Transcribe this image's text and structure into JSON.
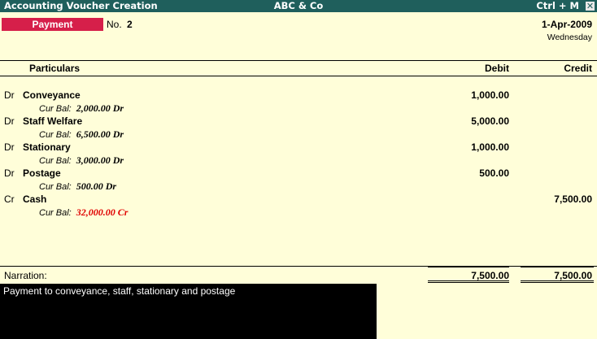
{
  "titlebar": {
    "left": "Accounting Voucher  Creation",
    "center": "ABC & Co",
    "right": "Ctrl + M",
    "close": "✕"
  },
  "voucher": {
    "type": "Payment",
    "no_label": "No.",
    "no_value": "2",
    "date": "1-Apr-2009",
    "day": "Wednesday"
  },
  "columns": {
    "particulars": "Particulars",
    "debit": "Debit",
    "credit": "Credit"
  },
  "entries": [
    {
      "drcr": "Dr",
      "ledger": "Conveyance",
      "debit": "1,000.00",
      "credit": "",
      "bal_label": "Cur Bal:",
      "bal_value": "2,000.00 Dr"
    },
    {
      "drcr": "Dr",
      "ledger": "Staff Welfare",
      "debit": "5,000.00",
      "credit": "",
      "bal_label": "Cur Bal:",
      "bal_value": "6,500.00 Dr"
    },
    {
      "drcr": "Dr",
      "ledger": "Stationary",
      "debit": "1,000.00",
      "credit": "",
      "bal_label": "Cur Bal:",
      "bal_value": "3,000.00 Dr"
    },
    {
      "drcr": "Dr",
      "ledger": "Postage",
      "debit": "500.00",
      "credit": "",
      "bal_label": "Cur Bal:",
      "bal_value": "500.00 Dr"
    },
    {
      "drcr": "Cr",
      "ledger": "Cash",
      "debit": "",
      "credit": "7,500.00",
      "bal_label": "Cur Bal:",
      "bal_value": "32,000.00 Cr"
    }
  ],
  "totals": {
    "narration_label": "Narration:",
    "debit": "7,500.00",
    "credit": "7,500.00"
  },
  "narration": {
    "text": "Payment to conveyance, staff, stationary and postage"
  },
  "colors": {
    "background": "#fffed9",
    "titlebar": "#1f5f5c",
    "voucher_type_bg": "#d61f4a",
    "negative_balance": "#e00000"
  }
}
